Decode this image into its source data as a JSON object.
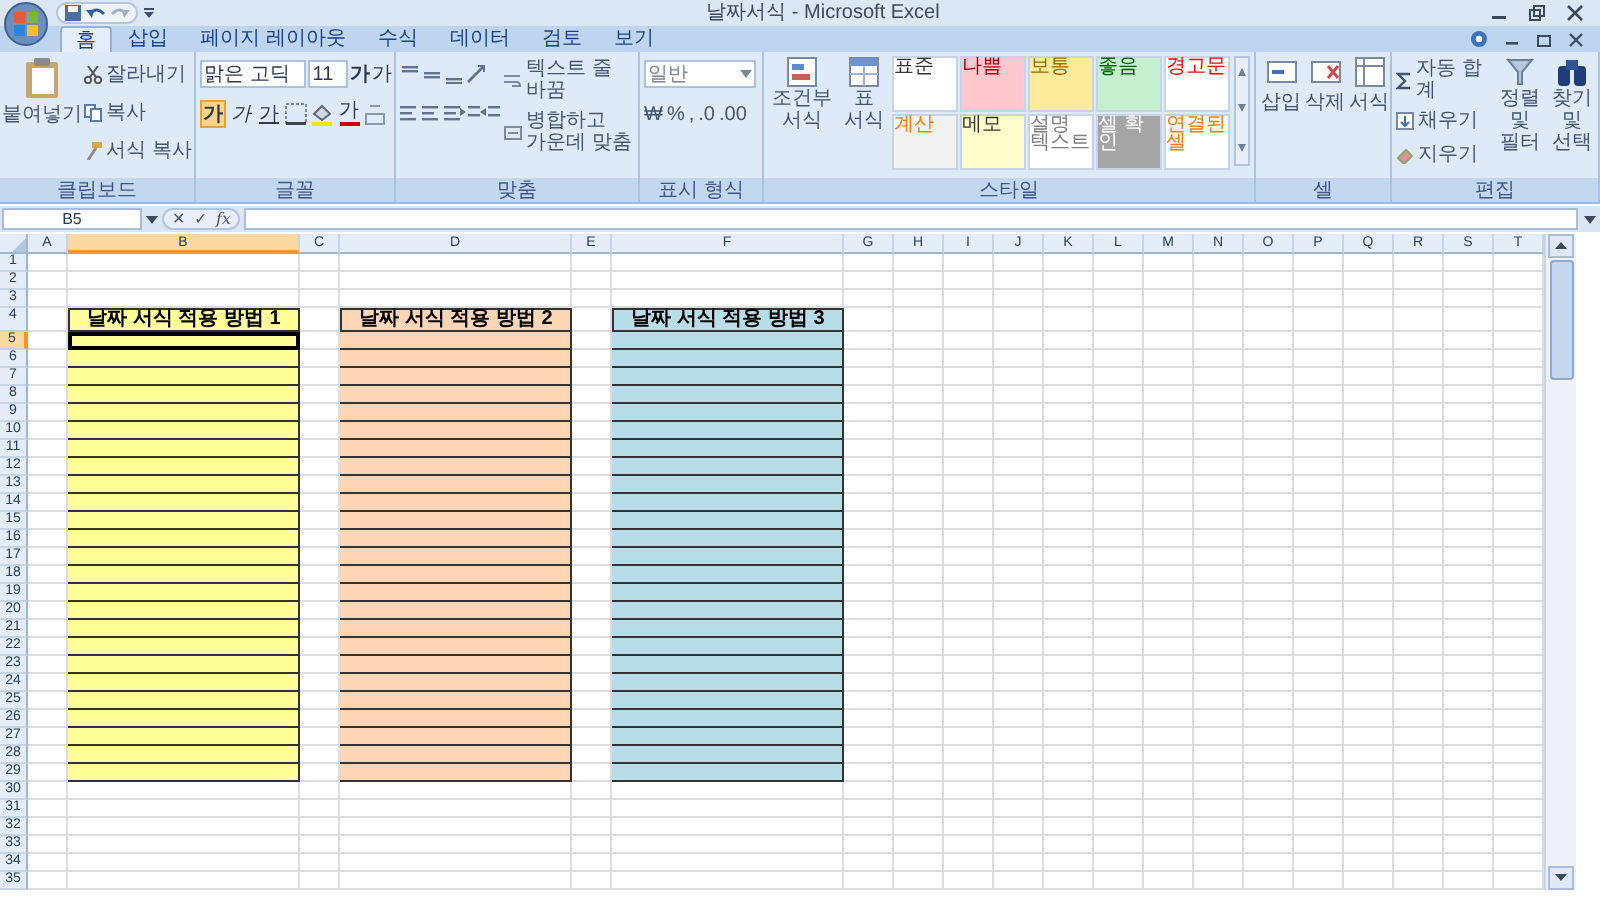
{
  "window": {
    "title": "날짜서식 - Microsoft Excel"
  },
  "tabs": [
    {
      "label": "홈",
      "selected": true
    },
    {
      "label": "삽입",
      "selected": false
    },
    {
      "label": "페이지 레이아웃",
      "selected": false
    },
    {
      "label": "수식",
      "selected": false
    },
    {
      "label": "데이터",
      "selected": false
    },
    {
      "label": "검토",
      "selected": false
    },
    {
      "label": "보기",
      "selected": false
    }
  ],
  "ribbon": {
    "clipboard": {
      "label": "클립보드",
      "paste": "붙여넣기",
      "items": [
        "잘라내기",
        "복사",
        "서식 복사"
      ]
    },
    "font": {
      "label": "글꼴",
      "name": "맑은 고딕",
      "size": "11",
      "grow": "가",
      "shrink": "가",
      "color_glyph": "가",
      "styles": [
        {
          "label": "가",
          "kind": "bold",
          "selected": true
        },
        {
          "label": "가",
          "kind": "italic",
          "selected": false
        },
        {
          "label": "가",
          "kind": "underline",
          "selected": false
        }
      ]
    },
    "alignment": {
      "label": "맞춤",
      "wrap": "텍스트 줄 바꿈",
      "merge": "병합하고 가운데 맞춤"
    },
    "number": {
      "label": "표시 형식",
      "format": "일반",
      "buttons": [
        "₩",
        "%",
        ",",
        ".0",
        ".00"
      ]
    },
    "styles": {
      "label": "스타일",
      "conditional": "조건부 서식",
      "table": "표 서식",
      "gallery": [
        {
          "label": "표준",
          "color": "#ffffff"
        },
        {
          "label": "나쁨",
          "color": "#ffc7ce"
        },
        {
          "label": "보통",
          "color": "#ffeb9c"
        },
        {
          "label": "좋음",
          "color": "#c6efce"
        },
        {
          "label": "경고문",
          "color": "#ffffff"
        },
        {
          "label": "계산",
          "color": "#f2f2f2"
        },
        {
          "label": "메모",
          "color": "#ffffcc"
        },
        {
          "label": "설명 텍스트",
          "color": "#ffffff"
        },
        {
          "label": "셀 확인",
          "color": "#a5a5a5"
        },
        {
          "label": "연결된 셀",
          "color": "#ffffff"
        }
      ]
    },
    "cells": {
      "label": "셀",
      "buttons": [
        "삽입",
        "삭제",
        "서식"
      ]
    },
    "editing": {
      "label": "편집",
      "autosum": "자동 합계",
      "fill": "채우기",
      "clear": "지우기",
      "sort": "정렬 및 필터",
      "find": "찾기 및 선택"
    }
  },
  "formula_bar": {
    "name_box": "B5",
    "cancel": "✕",
    "enter": "✓",
    "function": "fx"
  },
  "sheet": {
    "columns": [
      {
        "label": "A",
        "selected": false
      },
      {
        "label": "B",
        "selected": true
      },
      {
        "label": "C",
        "selected": false
      },
      {
        "label": "D",
        "selected": false
      },
      {
        "label": "E",
        "selected": false
      },
      {
        "label": "F",
        "selected": false
      },
      {
        "label": "G",
        "selected": false
      },
      {
        "label": "H",
        "selected": false
      },
      {
        "label": "I",
        "selected": false
      },
      {
        "label": "J",
        "selected": false
      },
      {
        "label": "K",
        "selected": false
      },
      {
        "label": "L",
        "selected": false
      },
      {
        "label": "M",
        "selected": false
      },
      {
        "label": "N",
        "selected": false
      },
      {
        "label": "O",
        "selected": false
      },
      {
        "label": "P",
        "selected": false
      },
      {
        "label": "Q",
        "selected": false
      },
      {
        "label": "R",
        "selected": false
      },
      {
        "label": "S",
        "selected": false
      },
      {
        "label": "T",
        "selected": false
      }
    ],
    "rows": [
      {
        "label": "1",
        "selected": false
      },
      {
        "label": "2",
        "selected": false
      },
      {
        "label": "3",
        "selected": false
      },
      {
        "label": "4",
        "selected": false
      },
      {
        "label": "5",
        "selected": true
      },
      {
        "label": "6",
        "selected": false
      },
      {
        "label": "7",
        "selected": false
      },
      {
        "label": "8",
        "selected": false
      },
      {
        "label": "9",
        "selected": false
      },
      {
        "label": "10",
        "selected": false
      },
      {
        "label": "11",
        "selected": false
      },
      {
        "label": "12",
        "selected": false
      },
      {
        "label": "13",
        "selected": false
      },
      {
        "label": "14",
        "selected": false
      },
      {
        "label": "15",
        "selected": false
      },
      {
        "label": "16",
        "selected": false
      },
      {
        "label": "17",
        "selected": false
      },
      {
        "label": "18",
        "selected": false
      },
      {
        "label": "19",
        "selected": false
      },
      {
        "label": "20",
        "selected": false
      },
      {
        "label": "21",
        "selected": false
      },
      {
        "label": "22",
        "selected": false
      },
      {
        "label": "23",
        "selected": false
      },
      {
        "label": "24",
        "selected": false
      },
      {
        "label": "25",
        "selected": false
      },
      {
        "label": "26",
        "selected": false
      },
      {
        "label": "27",
        "selected": false
      },
      {
        "label": "28",
        "selected": false
      },
      {
        "label": "29",
        "selected": false
      },
      {
        "label": "30",
        "selected": false
      },
      {
        "label": "31",
        "selected": false
      },
      {
        "label": "32",
        "selected": false
      },
      {
        "label": "33",
        "selected": false
      },
      {
        "label": "34",
        "selected": false
      },
      {
        "label": "35",
        "selected": false
      }
    ],
    "tables": [
      {
        "header": "날짜 서식 적용 방법 1",
        "color": "#ffff99"
      },
      {
        "header": "날짜 서식 적용 방법 2",
        "color": "#fcd5b4"
      },
      {
        "header": "날짜 서식 적용 방법 3",
        "color": "#b7dee8"
      }
    ]
  }
}
